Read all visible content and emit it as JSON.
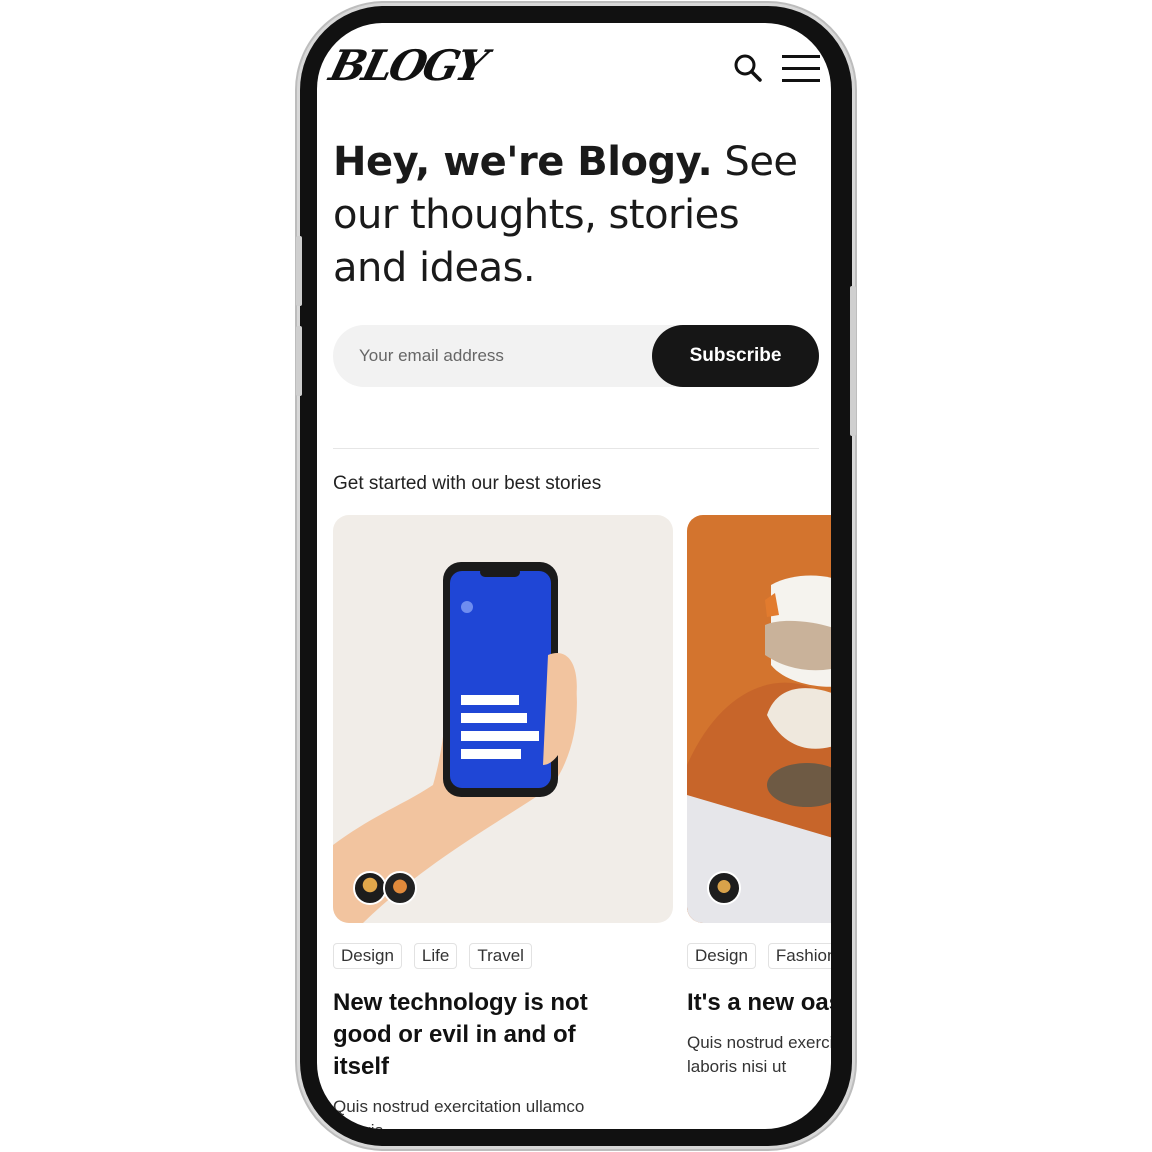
{
  "header": {
    "logo": "BLOGY"
  },
  "hero": {
    "bold": "Hey, we're Blogy.",
    "rest": " See our thoughts, stories and ideas."
  },
  "subscribe": {
    "placeholder": "Your email address",
    "button_label": "Subscribe"
  },
  "section": {
    "label": "Get started with our best stories"
  },
  "cards": [
    {
      "tags": [
        "Design",
        "Life",
        "Travel"
      ],
      "title": "New technology is not good or evil in and of itself",
      "excerpt": "Quis nostrud exercitation ullamco laboris",
      "image_desc": "hand holding phone",
      "colors": {
        "bg": "#f1ede8",
        "screen": "#1f46d6",
        "skin": "#f2c49f"
      }
    },
    {
      "tags": [
        "Design",
        "Fashion"
      ],
      "title": "It's a new oasis there are no",
      "excerpt": "Quis nostrud exercitation ullamco laboris nisi ut",
      "image_desc": "sneaker on orange",
      "colors": {
        "bg": "#d3742e",
        "shoe": "#f5f3ee"
      }
    }
  ]
}
